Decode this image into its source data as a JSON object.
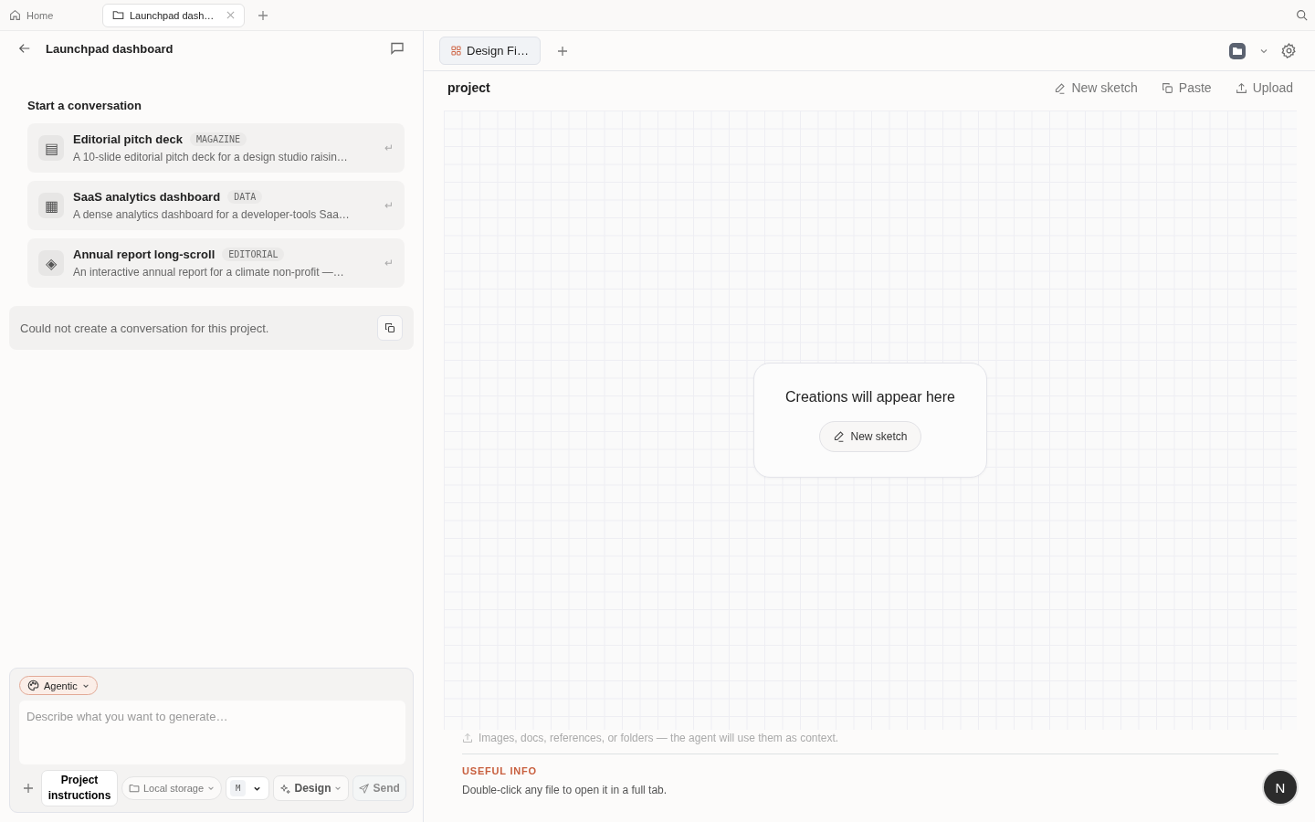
{
  "top_tabs": [
    {
      "label": "Home",
      "kind": "home",
      "selected": false
    },
    {
      "label": "Launchpad dash…",
      "kind": "folder",
      "selected": true
    }
  ],
  "left_panel": {
    "title": "Launchpad dashboard",
    "section_title": "Start a conversation",
    "templates": [
      {
        "glyph": "▤",
        "title": "Editorial pitch deck",
        "tag": "MAGAZINE",
        "description": "A 10-slide editorial pitch deck for a design studio raisin…",
        "enter": "↵"
      },
      {
        "glyph": "▦",
        "title": "SaaS analytics dashboard",
        "tag": "DATA",
        "description": "A dense analytics dashboard for a developer-tools Saa…",
        "enter": "↵"
      },
      {
        "glyph": "◈",
        "title": "Annual report long-scroll",
        "tag": "EDITORIAL",
        "description": "An interactive annual report for a climate non-profit —…",
        "enter": "↵"
      }
    ],
    "error": "Could not create a conversation for this project.",
    "composer": {
      "mode": "Agentic",
      "placeholder": "Describe what you want to generate…",
      "project_instructions": "Project instructions",
      "storage": "Local storage",
      "model": "M",
      "skill": "Design",
      "send": {
        "label": "Send",
        "disabled": true
      }
    }
  },
  "right_panel": {
    "tabs": [
      {
        "label": "Design Fi…",
        "selected": true
      }
    ],
    "title": "project",
    "actions": [
      {
        "kind": "sketch",
        "label": "New sketch"
      },
      {
        "kind": "paste",
        "label": "Paste"
      },
      {
        "kind": "upload",
        "label": "Upload"
      }
    ],
    "empty": {
      "message": "Creations will appear here",
      "button": "New sketch"
    },
    "drop_hint": "Images, docs, references, or folders — the agent will use them as context.",
    "info_heading": "USEFUL INFO",
    "info_text": "Double-click any file to open it in a full tab.",
    "avatar": "N"
  }
}
